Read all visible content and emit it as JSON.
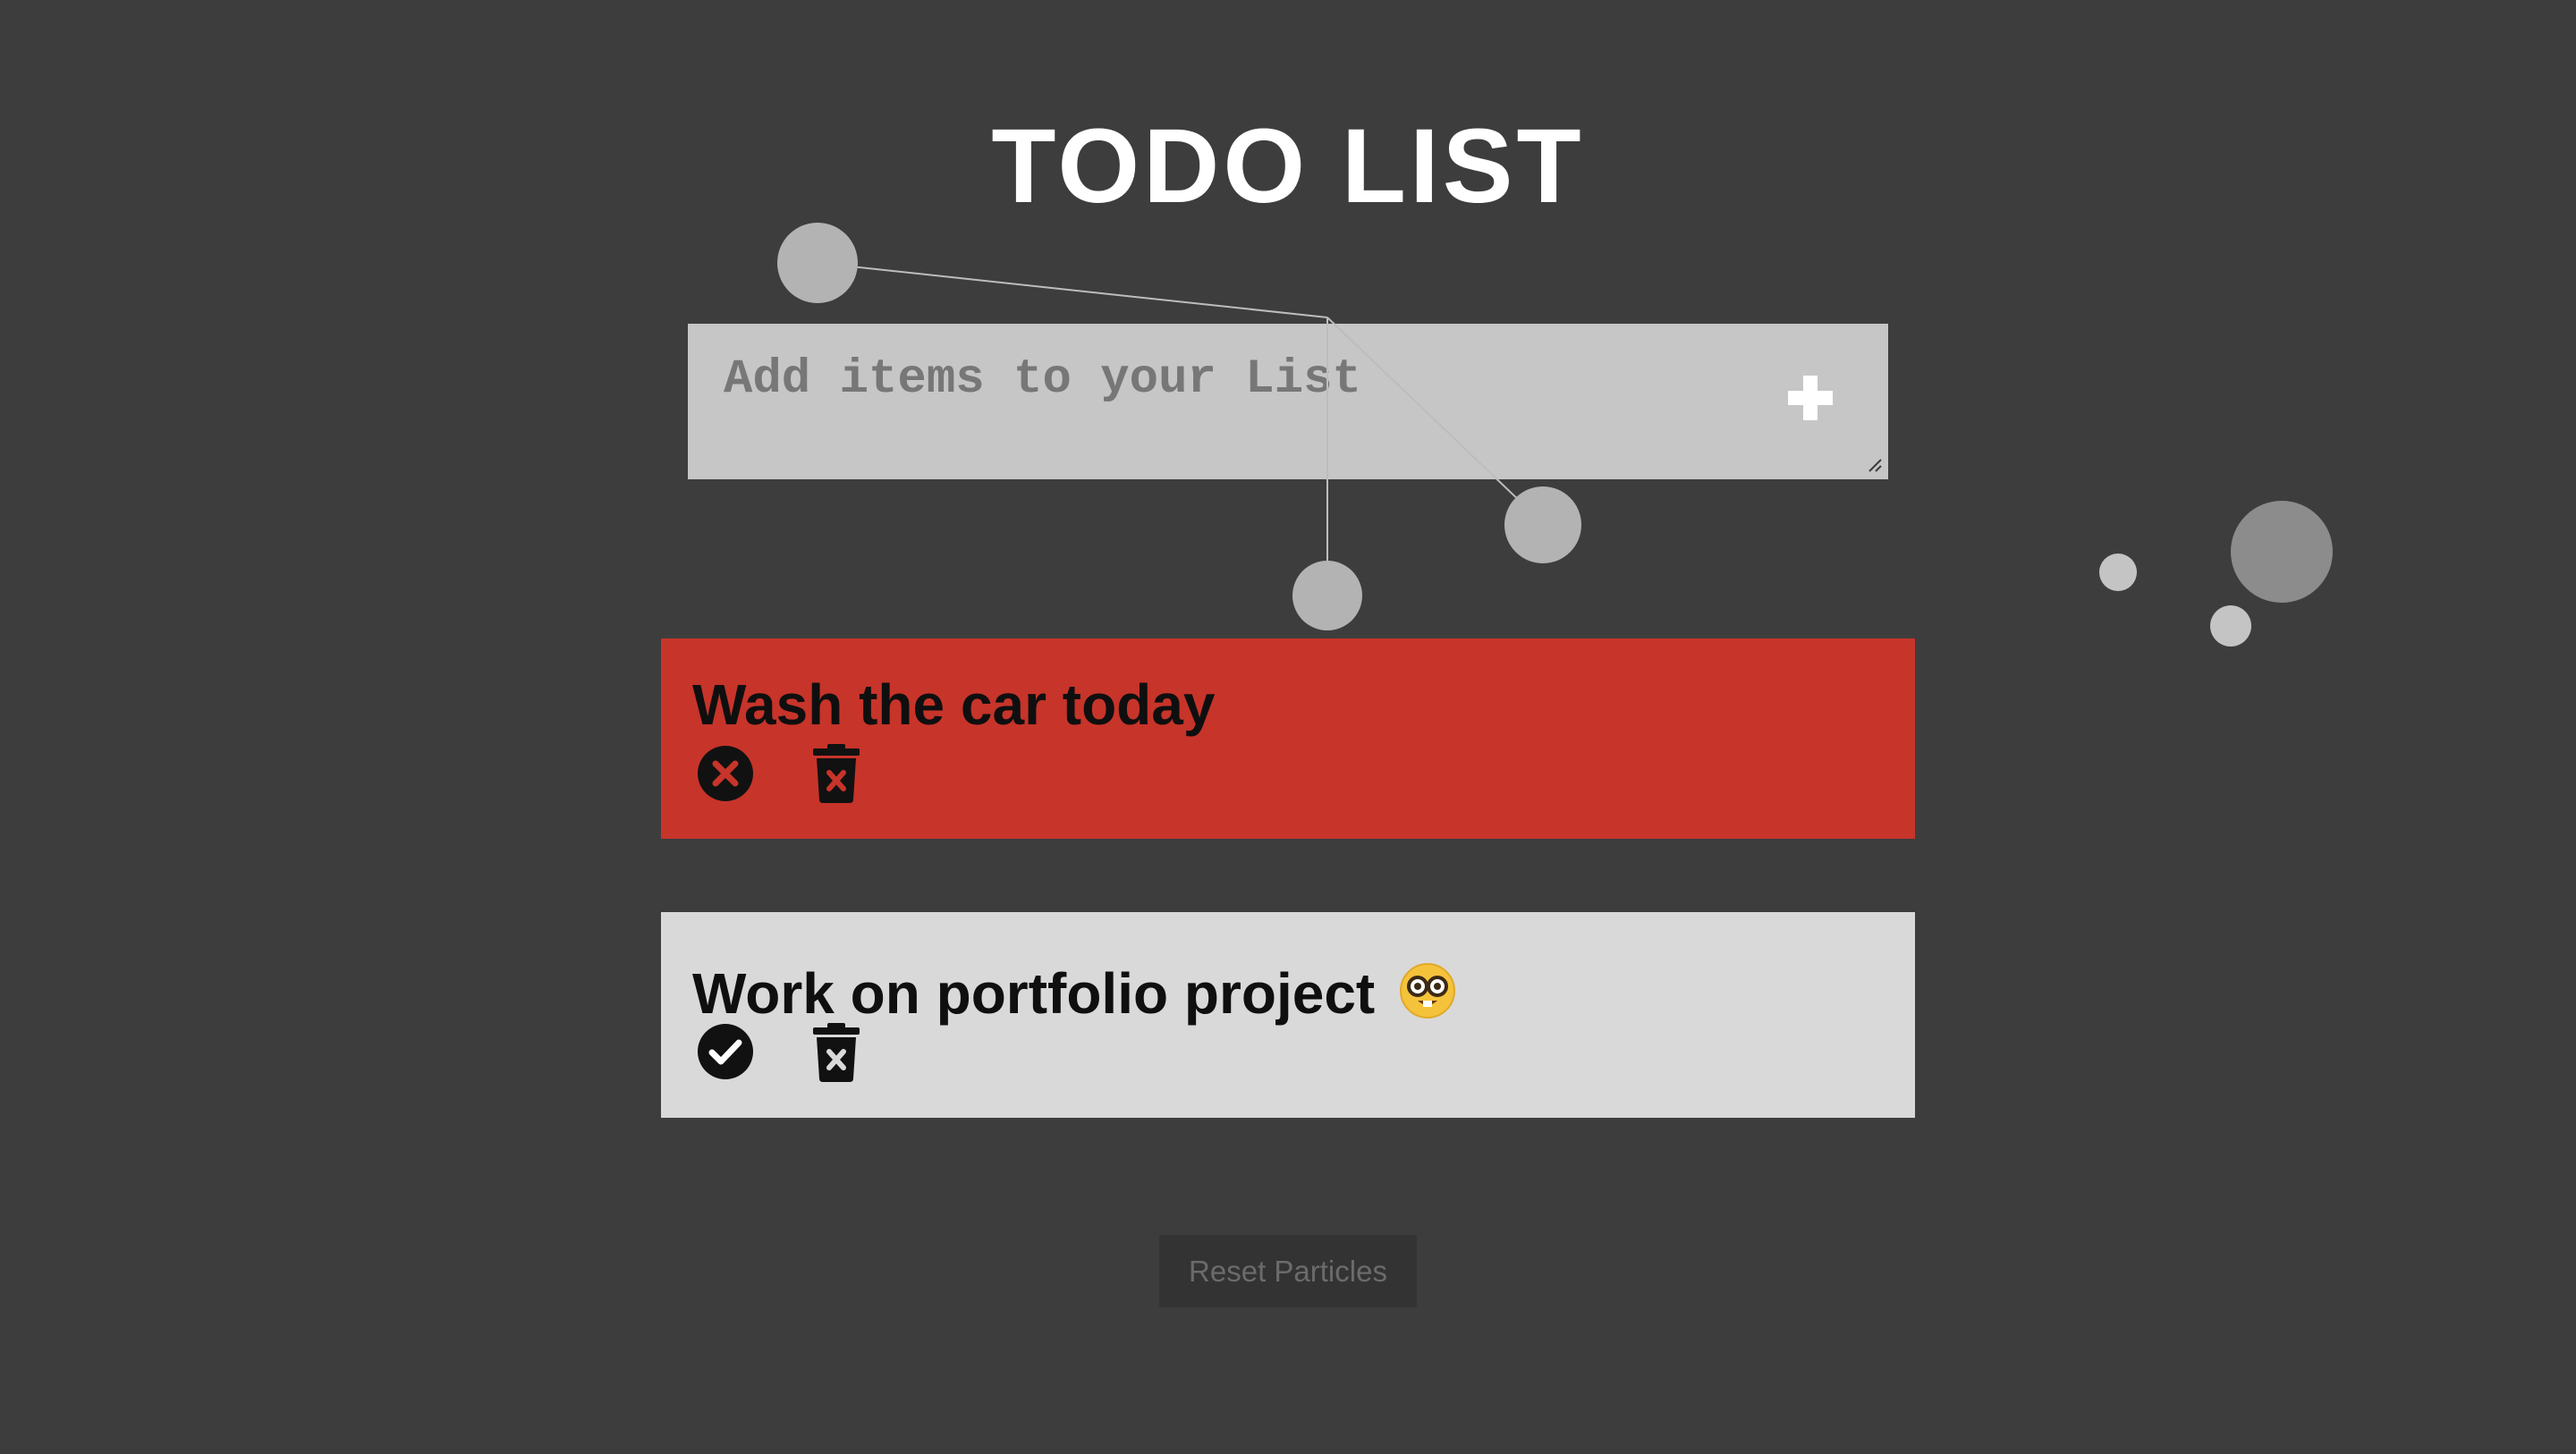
{
  "page": {
    "title": "TODO LIST"
  },
  "add_form": {
    "placeholder": "Add items to your List",
    "value": "",
    "add_icon": "plus-icon"
  },
  "todos": [
    {
      "text": "Wash the car today",
      "completed": false,
      "status_icon": "x-circle-icon",
      "delete_icon": "trash-icon",
      "background": "#c7342a"
    },
    {
      "text": "Work on portfolio project",
      "emoji": "nerd-face-emoji",
      "completed": true,
      "status_icon": "check-circle-icon",
      "delete_icon": "trash-icon",
      "background": "#d9d9d9"
    }
  ],
  "reset": {
    "label": "Reset Particles"
  },
  "colors": {
    "background": "#3d3d3d",
    "input_background": "#c6c6c6",
    "todo_pending": "#c7342a",
    "todo_done": "#d9d9d9",
    "text": "#0f0f0f",
    "title": "#ffffff"
  }
}
